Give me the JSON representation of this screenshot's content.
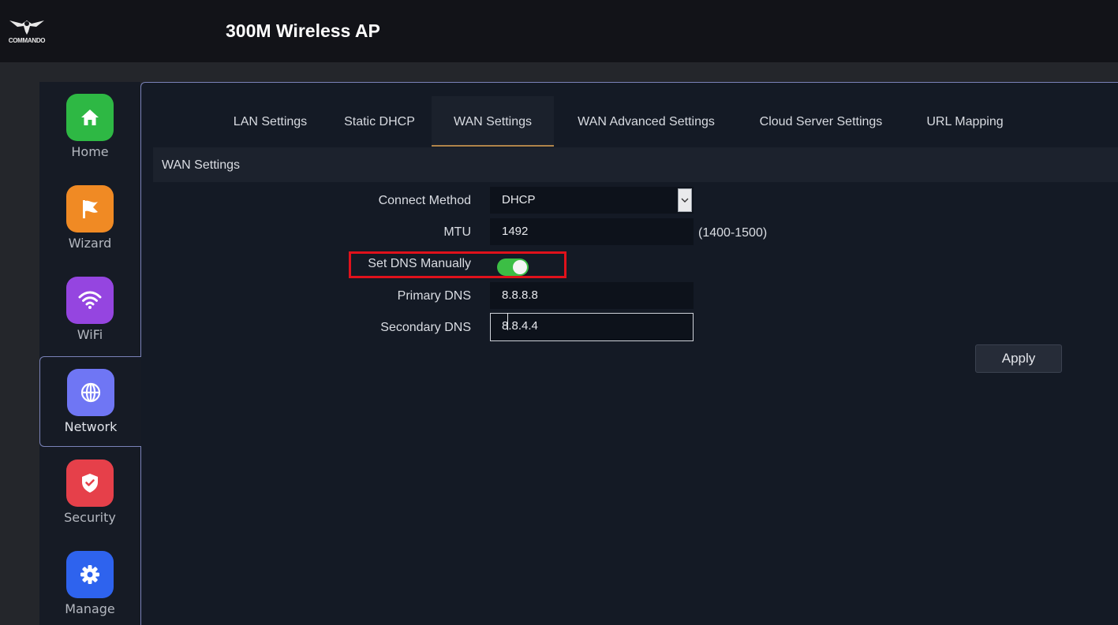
{
  "header": {
    "logo_text": "COMMANDO",
    "title": "300M Wireless AP"
  },
  "sidebar": {
    "items": [
      {
        "label": "Home",
        "icon": "home-icon",
        "color": "#2eb844"
      },
      {
        "label": "Wizard",
        "icon": "flag-icon",
        "color": "#f08a24"
      },
      {
        "label": "WiFi",
        "icon": "wifi-icon",
        "color": "#9545e0"
      },
      {
        "label": "Network",
        "icon": "globe-icon",
        "color": "#6f76f4",
        "active": true
      },
      {
        "label": "Security",
        "icon": "shield-icon",
        "color": "#e6404a"
      },
      {
        "label": "Manage",
        "icon": "gear-icon",
        "color": "#2e63ee"
      }
    ]
  },
  "tabs": [
    {
      "label": "LAN Settings"
    },
    {
      "label": "Static DHCP"
    },
    {
      "label": "WAN Settings",
      "active": true
    },
    {
      "label": "WAN Advanced Settings"
    },
    {
      "label": "Cloud Server Settings"
    },
    {
      "label": "URL Mapping"
    }
  ],
  "section": {
    "title": "WAN Settings"
  },
  "form": {
    "connect_method": {
      "label": "Connect Method",
      "value": "DHCP"
    },
    "mtu": {
      "label": "MTU",
      "value": "1492",
      "hint": "(1400-1500)"
    },
    "set_dns_manually": {
      "label": "Set DNS Manually",
      "enabled": true
    },
    "primary_dns": {
      "label": "Primary DNS",
      "value": "8.8.8.8"
    },
    "secondary_dns": {
      "label": "Secondary DNS",
      "value": "8.8.4.4"
    }
  },
  "apply_label": "Apply",
  "colors": {
    "toggle_on": "#3cbe45",
    "highlight": "#e0111b",
    "active_tab_underline": "#b1854a"
  }
}
